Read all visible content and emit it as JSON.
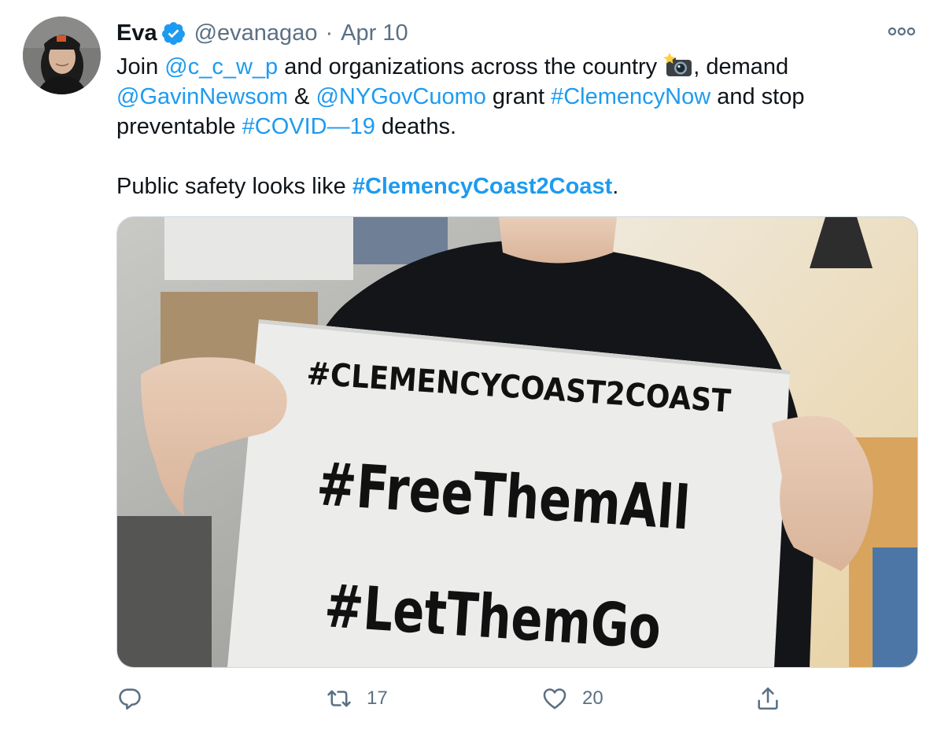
{
  "tweet": {
    "display_name": "Eva",
    "handle": "@evanagao",
    "separator": "·",
    "date": "Apr 10",
    "text": {
      "join": "Join ",
      "mention_ccwp": "@c_c_w_p",
      "across": " and organizations across the country ",
      "camera_emoji": "camera-with-flash",
      "demand": ", demand",
      "mention_newsom": "@GavinNewsom",
      "amp": " & ",
      "mention_cuomo": "@NYGovCuomo",
      "grant": " grant ",
      "hashtag_clemency_now": "#ClemencyNow",
      "and_stop": " and stop preventable ",
      "hashtag_covid": "#COVID—19",
      "deaths": " deaths.",
      "public_safety": "Public safety looks like ",
      "hashtag_coast": "#ClemencyCoast2Coast",
      "period": "."
    },
    "media": {
      "sign_line_1": "#CLEMENCYCOAST2COAST",
      "sign_line_2": "#FreeThemAll",
      "sign_line_3": "#LetThemGo"
    },
    "actions": {
      "reply_count": "",
      "retweet_count": "17",
      "like_count": "20"
    }
  },
  "colors": {
    "link": "#1d9bf0",
    "verified": "#1d9bf0",
    "secondary_text": "#5b7083"
  },
  "icons": [
    "verified-badge-icon",
    "more-icon",
    "camera-with-flash-icon",
    "reply-icon",
    "retweet-icon",
    "like-icon",
    "share-icon"
  ]
}
